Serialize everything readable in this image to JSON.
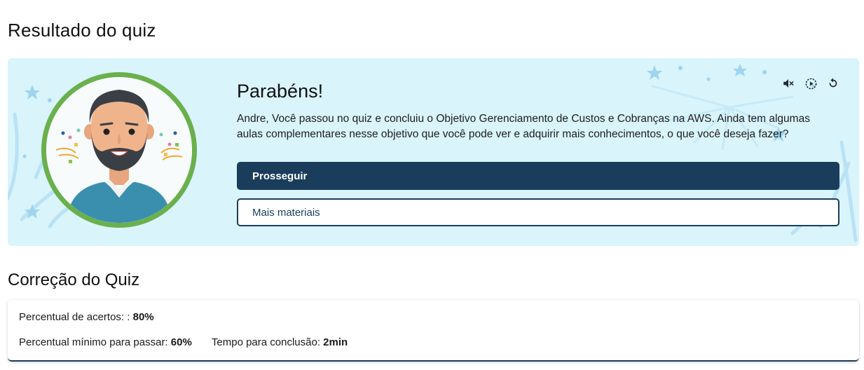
{
  "page": {
    "title": "Resultado do quiz"
  },
  "result": {
    "heading": "Parabéns!",
    "message": "Andre, Você passou no quiz e concluiu o Objetivo Gerenciamento de Custos e Cobranças na AWS. Ainda tem algumas aulas complementares nesse objetivo que você pode ver e adquirir mais conhecimentos, o que você deseja fazer?",
    "primary_button": "Prosseguir",
    "secondary_button": "Mais materiais",
    "controls": [
      {
        "icon": "volume-mute-icon"
      },
      {
        "icon": "play-circle-icon"
      },
      {
        "icon": "replay-icon"
      }
    ]
  },
  "correction": {
    "title": "Correção do Quiz",
    "score_label": "Percentual de acertos: :",
    "score_value": "80%",
    "min_label": "Percentual mínimo para passar:",
    "min_value": "60%",
    "time_label": "Tempo para conclusão:",
    "time_value": "2min"
  },
  "colors": {
    "card_bg": "#d9f4fb",
    "primary": "#1b3d5c",
    "avatar_ring": "#6ab04c"
  }
}
